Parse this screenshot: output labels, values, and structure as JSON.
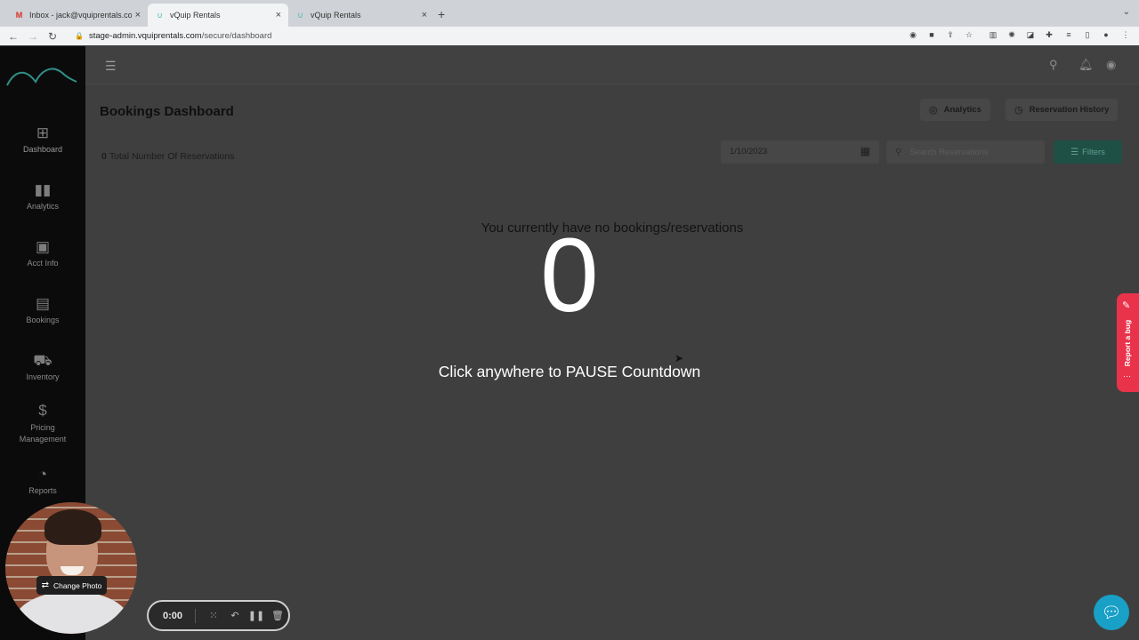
{
  "browser": {
    "tabs": [
      {
        "title": "Inbox - jack@vquiprentals.com",
        "icon": "gmail-icon",
        "active": false
      },
      {
        "title": "vQuip Rentals",
        "icon": "vquip-icon",
        "active": true
      },
      {
        "title": "vQuip Rentals",
        "icon": "vquip-icon",
        "active": false
      }
    ],
    "url_domain": "stage-admin.vquiprentals.com",
    "url_path": "/secure/dashboard"
  },
  "sidebar": {
    "items": [
      {
        "label": "Dashboard",
        "icon": "grid-icon"
      },
      {
        "label": "Analytics",
        "icon": "bar-chart-icon"
      },
      {
        "label": "Acct Info",
        "icon": "account-card-icon"
      },
      {
        "label": "Bookings",
        "icon": "calendar-icon"
      },
      {
        "label": "Inventory",
        "icon": "inventory-icon"
      },
      {
        "label": "Pricing Management",
        "icon": "dollar-icon"
      },
      {
        "label": "Reports",
        "icon": "pie-chart-icon"
      }
    ]
  },
  "header": {
    "title": "Bookings Dashboard",
    "analytics_label": "Analytics",
    "history_label": "Reservation History"
  },
  "summary": {
    "total_count": "0",
    "total_label": "Total Number Of Reservations"
  },
  "filters": {
    "date_value": "1/10/2023",
    "search_placeholder": "Search Reservations",
    "filters_label": "Filters"
  },
  "empty_state": "You currently have no bookings/reservations",
  "recorder": {
    "countdown": "0",
    "pause_hint": "Click anywhere to PAUSE Countdown",
    "time": "0:00",
    "change_photo_label": "Change Photo"
  },
  "report_bug_label": "Report a bug",
  "colors": {
    "accent": "#1f5046",
    "report_bug": "#e9334b",
    "chat": "#19a0c6"
  }
}
